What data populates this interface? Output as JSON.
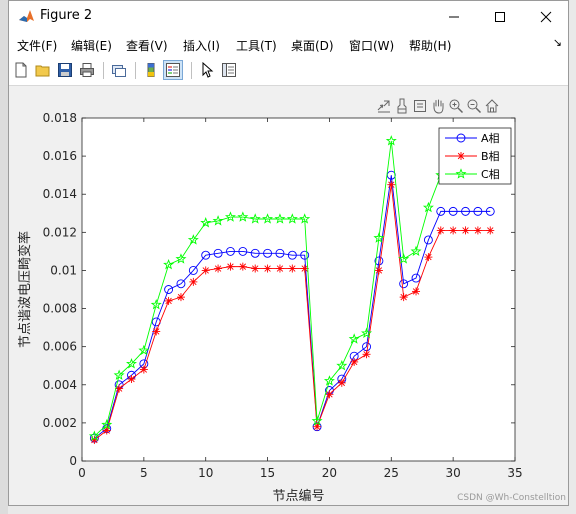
{
  "window": {
    "title": "Figure 2"
  },
  "menu": {
    "file": "文件(F)",
    "edit": "编辑(E)",
    "view": "查看(V)",
    "insert": "插入(I)",
    "tools": "工具(T)",
    "desktop": "桌面(D)",
    "window": "窗口(W)",
    "help": "帮助(H)"
  },
  "toolbar": {
    "icons": [
      "new-figure-icon",
      "open-file-icon",
      "save-icon",
      "print-icon",
      "link-icon",
      "colorbar-icon",
      "legend-icon",
      "pointer-icon",
      "property-inspector-icon"
    ]
  },
  "axes_toolbar": {
    "icons": [
      "export-icon",
      "brush-icon",
      "datatip-icon",
      "pan-icon",
      "zoom-in-icon",
      "zoom-out-icon",
      "home-icon"
    ]
  },
  "watermark": "CSDN @Wh-Constelltion",
  "chart_data": {
    "type": "line",
    "xlabel": "节点编号",
    "ylabel": "节点谐波电压畸变率",
    "xlim": [
      0,
      35
    ],
    "ylim": [
      0,
      0.018
    ],
    "xticks": [
      "0",
      "5",
      "10",
      "15",
      "20",
      "25",
      "30",
      "35"
    ],
    "yticks": [
      "0",
      "0.002",
      "0.004",
      "0.006",
      "0.008",
      "0.01",
      "0.012",
      "0.014",
      "0.016",
      "0.018"
    ],
    "grid": false,
    "legend_position": "top-right",
    "x": [
      1,
      2,
      3,
      4,
      5,
      6,
      7,
      8,
      9,
      10,
      11,
      12,
      13,
      14,
      15,
      16,
      17,
      18,
      19,
      20,
      21,
      22,
      23,
      24,
      25,
      26,
      27,
      28,
      29,
      30,
      31,
      32,
      33
    ],
    "series": [
      {
        "name": "A相",
        "color": "#0000ff",
        "marker": "circle",
        "values": [
          0.0012,
          0.0017,
          0.004,
          0.0045,
          0.0051,
          0.0073,
          0.009,
          0.0093,
          0.01,
          0.0108,
          0.0109,
          0.011,
          0.011,
          0.0109,
          0.0109,
          0.0109,
          0.0108,
          0.0108,
          0.0018,
          0.0037,
          0.0043,
          0.0055,
          0.006,
          0.0105,
          0.015,
          0.0093,
          0.0096,
          0.0116,
          0.0131,
          0.0131,
          0.0131,
          0.0131,
          0.0131
        ]
      },
      {
        "name": "B相",
        "color": "#ff0000",
        "marker": "asterisk",
        "values": [
          0.0011,
          0.0016,
          0.0038,
          0.0043,
          0.0048,
          0.0068,
          0.0084,
          0.0086,
          0.0094,
          0.01,
          0.0101,
          0.0102,
          0.0102,
          0.0101,
          0.0101,
          0.0101,
          0.0101,
          0.0101,
          0.0018,
          0.0035,
          0.0041,
          0.0052,
          0.0056,
          0.01,
          0.0145,
          0.0086,
          0.0089,
          0.0107,
          0.0121,
          0.0121,
          0.0121,
          0.0121,
          0.0121
        ]
      },
      {
        "name": "C相",
        "color": "#00ff00",
        "marker": "pentagram",
        "values": [
          0.0013,
          0.0019,
          0.0045,
          0.0051,
          0.0058,
          0.0082,
          0.0103,
          0.0106,
          0.0116,
          0.0125,
          0.0126,
          0.0128,
          0.0128,
          0.0127,
          0.0127,
          0.0127,
          0.0127,
          0.0127,
          0.0021,
          0.0042,
          0.005,
          0.0064,
          0.0067,
          0.0117,
          0.0168,
          0.0106,
          0.011,
          0.0133,
          0.015,
          0.015,
          0.015,
          0.015,
          0.015
        ]
      }
    ]
  }
}
